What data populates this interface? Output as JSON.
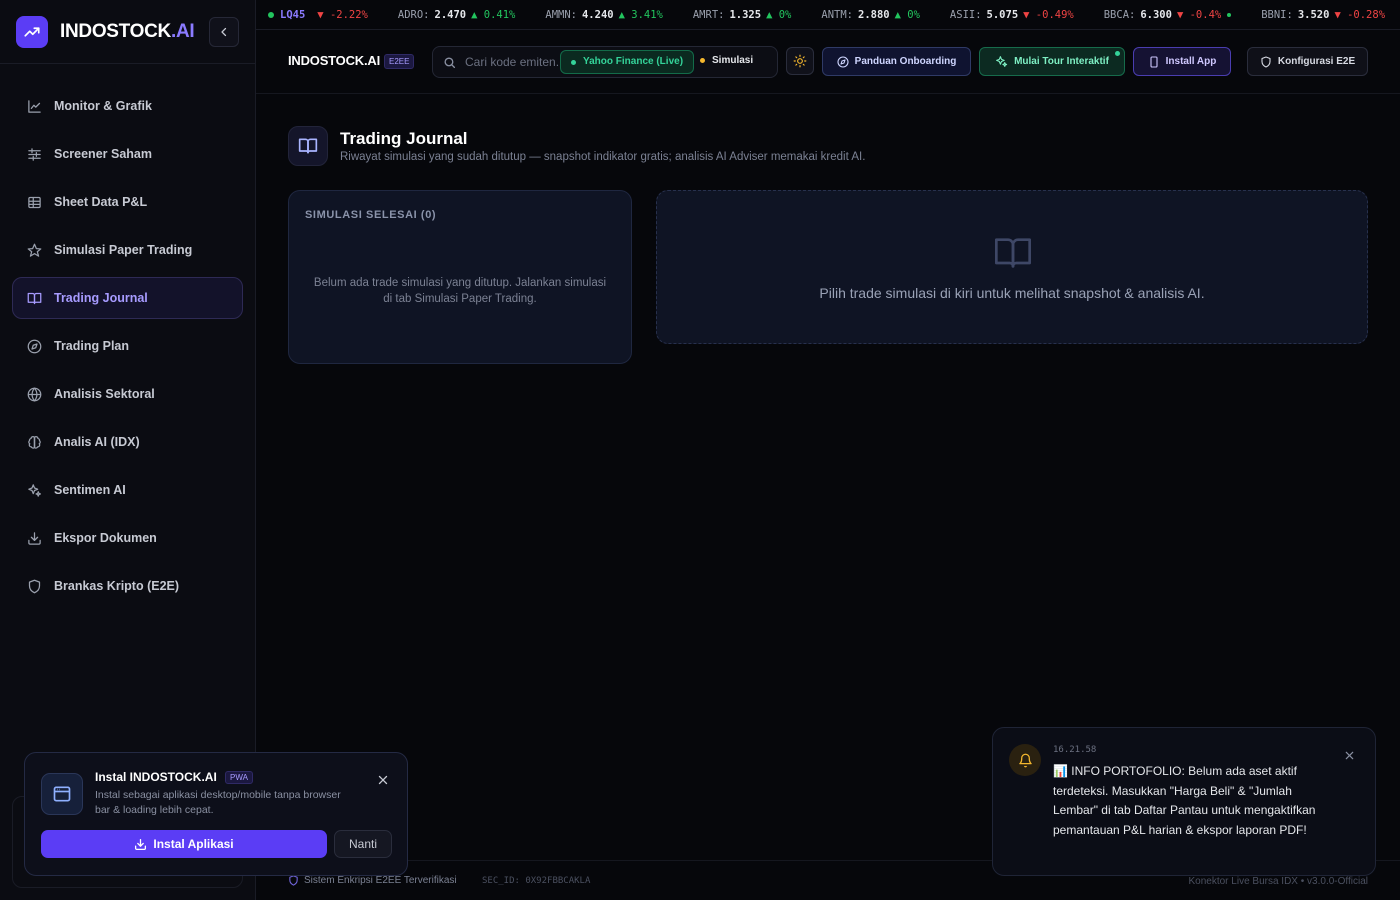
{
  "sidebar": {
    "brand_main": "INDOSTOCK",
    "brand_suffix": ".AI",
    "items": [
      {
        "label": "Monitor & Grafik"
      },
      {
        "label": "Screener Saham"
      },
      {
        "label": "Sheet Data P&L"
      },
      {
        "label": "Simulasi Paper Trading"
      },
      {
        "label": "Trading Journal",
        "active": true
      },
      {
        "label": "Trading Plan"
      },
      {
        "label": "Analisis Sektoral"
      },
      {
        "label": "Analis AI (IDX)"
      },
      {
        "label": "Sentimen AI"
      },
      {
        "label": "Ekspor Dokumen"
      },
      {
        "label": "Brankas Kripto (E2E)"
      }
    ]
  },
  "ticker": [
    {
      "code": "LQ45",
      "price": "",
      "change": "-2.22%",
      "dir": "down"
    },
    {
      "code": "ADRO:",
      "price": "2.470",
      "change": "0.41%",
      "dir": "up"
    },
    {
      "code": "AMMN:",
      "price": "4.240",
      "change": "3.41%",
      "dir": "up"
    },
    {
      "code": "AMRT:",
      "price": "1.325",
      "change": "0%",
      "dir": "up"
    },
    {
      "code": "ANTM:",
      "price": "2.880",
      "change": "0%",
      "dir": "up"
    },
    {
      "code": "ASII:",
      "price": "5.075",
      "change": "-0.49%",
      "dir": "down"
    },
    {
      "code": "BBCA:",
      "price": "6.300",
      "change": "-0.4%",
      "dir": "down"
    },
    {
      "code": "BBNI:",
      "price": "3.520",
      "change": "-0.28%",
      "dir": "down"
    }
  ],
  "header": {
    "title": "INDOSTOCK.AI",
    "badge": "E2EE",
    "search_placeholder": "Cari kode emiten...",
    "source_live": "Yahoo Finance (Live)",
    "source_sim": "Simulasi",
    "guide_label": "Panduan Onboarding",
    "tour_label": "Mulai Tour Interaktif",
    "install_label": "Install App",
    "e2e_label": "Konfigurasi E2E"
  },
  "main": {
    "title": "Trading Journal",
    "subtitle": "Riwayat simulasi yang sudah ditutup — snapshot indikator gratis; analisis AI Adviser memakai kredit AI.",
    "left_card_title": "SIMULASI SELESAI (0)",
    "left_card_empty": "Belum ada trade simulasi yang ditutup. Jalankan simulasi di tab Simulasi Paper Trading.",
    "right_card_msg": "Pilih trade simulasi di kiri untuk melihat snapshot & analisis AI."
  },
  "footer": {
    "secure": "Sistem Enkripsi E2EE Terverifikasi",
    "sec_id": "SEC_ID: 0X92FBBCAKLA",
    "version": "Konektor Live Bursa IDX • v3.0.0-Official"
  },
  "pwa": {
    "title": "Instal INDOSTOCK.AI",
    "badge": "PWA",
    "desc": "Instal sebagai aplikasi desktop/mobile tanpa browser bar & loading lebih cepat.",
    "install": "Instal Aplikasi",
    "later": "Nanti"
  },
  "toast": {
    "time": "16.21.58",
    "message": "📊 INFO PORTOFOLIO: Belum ada aset aktif terdeteksi. Masukkan \"Harga Beli\" & \"Jumlah Lembar\" di tab Daftar Pantau untuk mengaktifkan pemantauan P&L harian & ekspor laporan PDF!"
  },
  "colors": {
    "accent": "#5b3df5",
    "up": "#22c55e",
    "down": "#ef4444",
    "live": "#34d399"
  }
}
